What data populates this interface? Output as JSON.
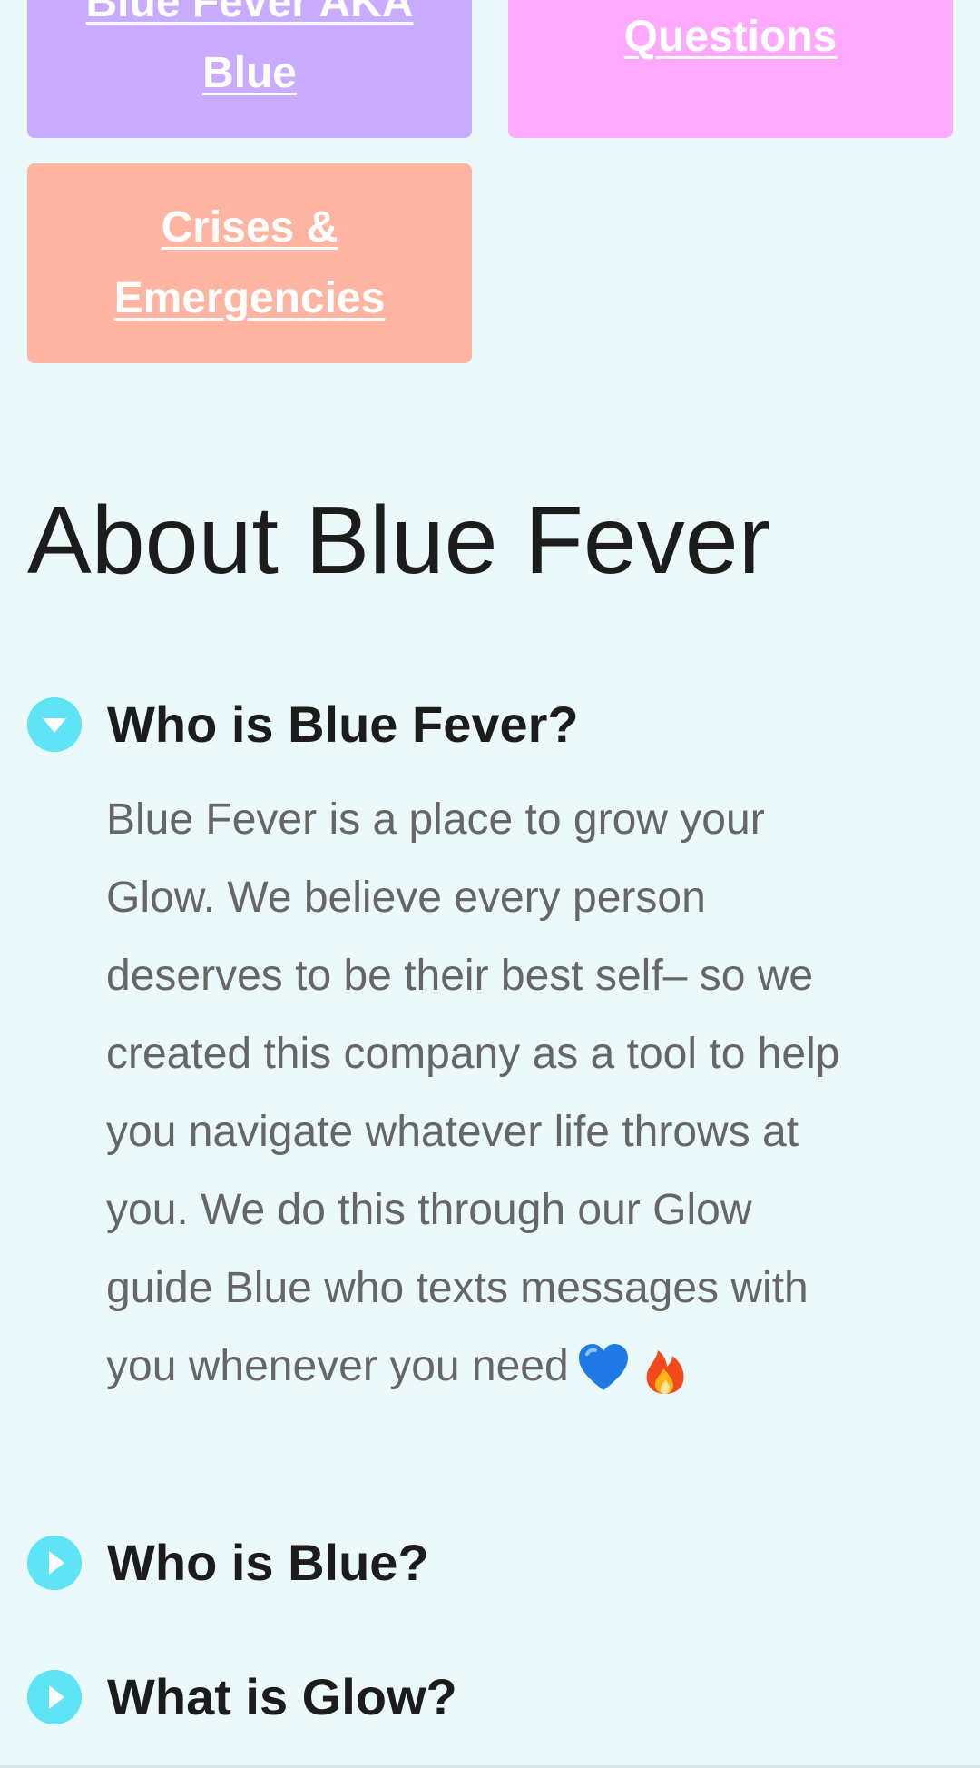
{
  "categories": [
    {
      "id": "blue",
      "label": "Blue Fever AKA Blue",
      "color": "#c9abff"
    },
    {
      "id": "questions",
      "label": "Questions",
      "color": "#ffaaff"
    },
    {
      "id": "crises",
      "label": "Crises & Emergencies",
      "color": "#ffb5a2"
    }
  ],
  "about": {
    "title": "About Blue Fever"
  },
  "faq": [
    {
      "question": "Who is Blue Fever?",
      "expanded": true,
      "answer": "Blue Fever is a place to grow your Glow. We believe every person deserves to be their best self– so we created this company as a tool to help you navigate whatever life throws at you. We do this through our Glow guide Blue who texts messages with you whenever you need",
      "answer_emojis": [
        "blue-heart-icon",
        "fire-icon"
      ]
    },
    {
      "question": "Who is Blue?",
      "expanded": false
    },
    {
      "question": "What is Glow?",
      "expanded": false
    }
  ],
  "colors": {
    "background": "#ecf9fb",
    "accent": "#5ee4f4",
    "answer_text": "#666666"
  }
}
